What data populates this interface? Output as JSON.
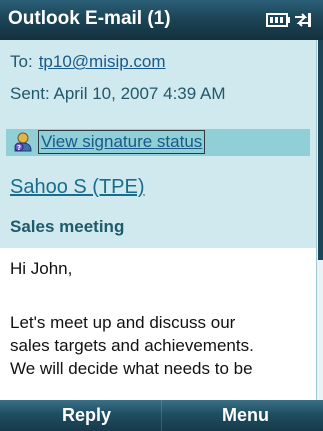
{
  "titlebar": {
    "title": "Outlook E-mail (1)",
    "icons": [
      "battery-icon",
      "connectivity-icon"
    ]
  },
  "header": {
    "to_label": "To:",
    "to_address": "tp10@misip.com",
    "sent": "Sent: April 10, 2007 4:39 AM",
    "signature_link": "View signature status",
    "signature_icon": "certificate-person-icon",
    "sender": "Sahoo S (TPE)",
    "subject": "Sales meeting"
  },
  "body": {
    "greeting": "Hi John,",
    "lines": [
      "Let's meet up and discuss our",
      "sales targets and achievements.",
      "We will decide what needs to be"
    ]
  },
  "softkeys": {
    "left": "Reply",
    "right": "Menu"
  },
  "colors": {
    "titlebar": "#1c4557",
    "header_bg": "#cfe9ef",
    "signature_bg": "#8fcfd5",
    "link": "#1a5a8a"
  }
}
